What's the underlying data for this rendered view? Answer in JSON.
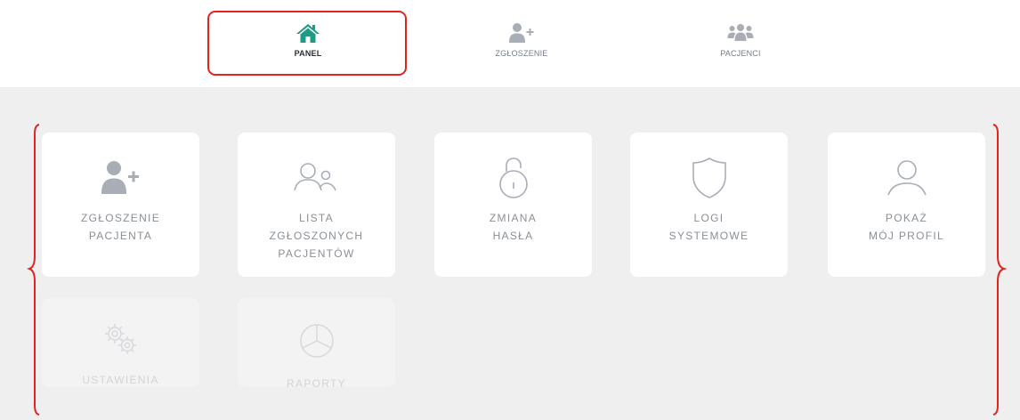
{
  "nav": {
    "items": [
      {
        "label": "PANEL",
        "icon": "home-icon",
        "active": true
      },
      {
        "label": "ZGŁOSZENIE",
        "icon": "add-user-icon",
        "active": false
      },
      {
        "label": "PACJENCI",
        "icon": "users-group-icon",
        "active": false
      }
    ]
  },
  "tiles": [
    {
      "label": "ZGŁOSZENIE\nPACJENTA",
      "icon": "add-user-icon"
    },
    {
      "label": "LISTA\nZGŁOSZONYCH\nPACJENTÓW",
      "icon": "users-outline-icon"
    },
    {
      "label": "ZMIANA\nHASŁA",
      "icon": "padlock-open-icon"
    },
    {
      "label": "LOGI\nSYSTEMOWE",
      "icon": "shield-icon"
    },
    {
      "label": "POKAŻ\nMÓJ PROFIL",
      "icon": "user-outline-icon"
    }
  ],
  "disabled_tiles": [
    {
      "label": "USTAWIENIA",
      "icon": "gears-icon"
    },
    {
      "label": "RAPORTY",
      "icon": "pie-chart-icon"
    }
  ],
  "colors": {
    "accent": "#1f9a86",
    "highlight": "#e2241f",
    "icon_gray": "#a9adb5",
    "background": "#efefef"
  }
}
